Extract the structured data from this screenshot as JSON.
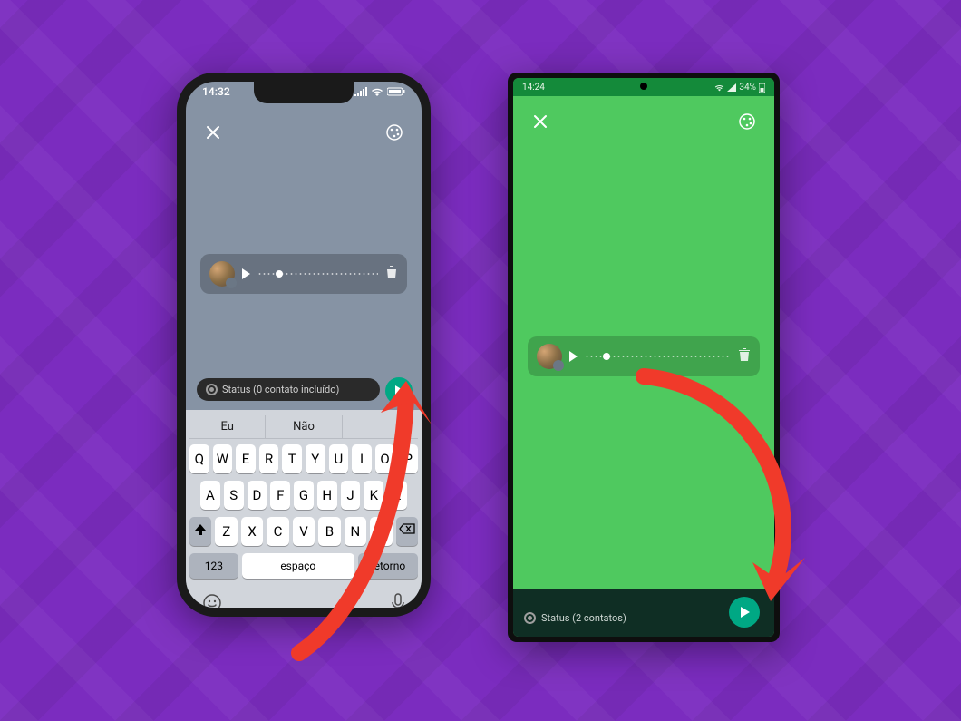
{
  "iphone": {
    "status_time": "14:32",
    "recipient_label": "Status (0 contato incluído)",
    "keyboard": {
      "suggest1": "Eu",
      "suggest2": "Não",
      "suggest3": "",
      "row1": [
        "Q",
        "W",
        "E",
        "R",
        "T",
        "Y",
        "U",
        "I",
        "O",
        "P"
      ],
      "row2": [
        "A",
        "S",
        "D",
        "F",
        "G",
        "H",
        "J",
        "K",
        "L"
      ],
      "row3": [
        "Z",
        "X",
        "C",
        "V",
        "B",
        "N",
        "M"
      ],
      "numeric_label": "123",
      "space_label": "espaço",
      "return_label": "retorno"
    }
  },
  "android": {
    "status_time": "14:24",
    "battery_label": "34%",
    "recipient_label": "Status (2 contatos)"
  },
  "icons": {
    "close": "close-icon",
    "palette": "palette-icon",
    "play": "play-icon",
    "trash": "trash-icon",
    "send": "send-icon",
    "emoji": "emoji-icon",
    "mic": "mic-icon",
    "shift": "shift-icon",
    "backspace": "backspace-icon"
  },
  "colors": {
    "background": "#7b2cbf",
    "iphone_canvas": "#8693a4",
    "android_canvas": "#4fc95f",
    "send_green": "#00a884",
    "arrow_red": "#f03a2a"
  }
}
